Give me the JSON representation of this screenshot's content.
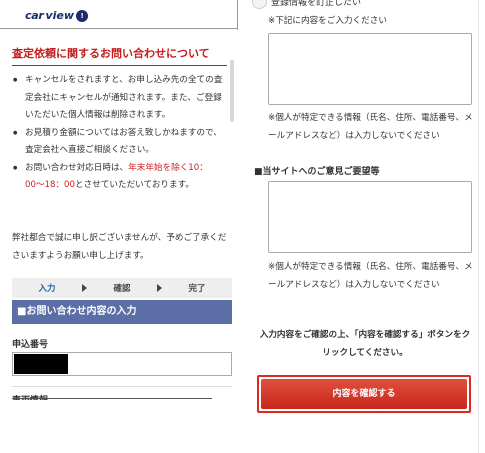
{
  "header": {
    "logo_car": "car",
    "logo_view": "view",
    "logo_badge": "!"
  },
  "left": {
    "section_title": "査定依頼に関するお問い合わせについて",
    "bullets": {
      "b1": "キャンセルをされますと、お申し込み先の全ての査定会社にキャンセルが通知されます。また、ご登録いただいた個人情報は削除されます。",
      "b2": "お見積り金額についてはお答え致しかねますので、査定会社へ直接ご相談ください。",
      "b3_pre": "お問い合わせ対応日時は、",
      "b3_red": "年末年始を除く10：00〜18：00",
      "b3_post": "とさせていただいております。"
    },
    "notice": "弊社都合で誠に申し訳ございませんが、予めご了承くださいますようお願い申し上げます。",
    "steps": [
      "入力",
      "確認",
      "完了"
    ],
    "form_header": "■お問い合わせ内容の入力",
    "application_label": "申込番号",
    "cut_label": "車両情報"
  },
  "right": {
    "radio_label": "登録情報を訂正したい",
    "note_enter": "※下記に内容をご入力ください",
    "note_privacy": "※個人が特定できる情報（氏名、住所、電話番号、メールアドレスなど）は入力しないでください",
    "opinion_heading": "■当サイトへのご意見ご要望等",
    "note_privacy_2": "※個人が特定できる情報（氏名、住所、電話番号、メールアドレスなど）は入力しないでください",
    "confirm_instruction": "入力内容をご確認の上、「内容を確認する」ボタンをクリックしてください。",
    "confirm_button": "内容を確認する"
  }
}
